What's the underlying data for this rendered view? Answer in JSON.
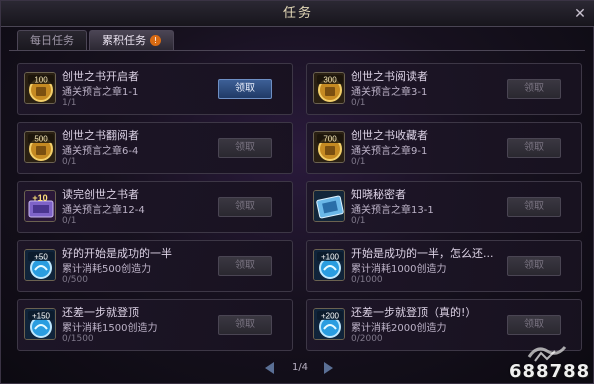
{
  "window": {
    "title": "任务"
  },
  "tabs": [
    {
      "label": "每日任务",
      "active": false
    },
    {
      "label": "累积任务",
      "active": true,
      "badge": "!"
    }
  ],
  "quests": [
    {
      "title": "创世之书开启者",
      "desc": "通关预言之章1-1",
      "progress": "1/1",
      "button": "领取",
      "claimable": true,
      "icon": "coin-100-icon",
      "icon_label": "100"
    },
    {
      "title": "创世之书阅读者",
      "desc": "通关预言之章3-1",
      "progress": "0/1",
      "button": "领取",
      "claimable": false,
      "icon": "coin-300-icon",
      "icon_label": "300"
    },
    {
      "title": "创世之书翻阅者",
      "desc": "通关预言之章6-4",
      "progress": "0/1",
      "button": "领取",
      "claimable": false,
      "icon": "coin-500-icon",
      "icon_label": "500"
    },
    {
      "title": "创世之书收藏者",
      "desc": "通关预言之章9-1",
      "progress": "0/1",
      "button": "领取",
      "claimable": false,
      "icon": "coin-700-icon",
      "icon_label": "700"
    },
    {
      "title": "读完创世之书者",
      "desc": "通关预言之章12-4",
      "progress": "0/1",
      "button": "领取",
      "claimable": false,
      "icon": "ticket-10-icon",
      "icon_label": "+10"
    },
    {
      "title": "知晓秘密者",
      "desc": "通关预言之章13-1",
      "progress": "0/1",
      "button": "领取",
      "claimable": false,
      "icon": "ticket-blue-icon",
      "icon_label": ""
    },
    {
      "title": "好的开始是成功的一半",
      "desc": "累计消耗500创造力",
      "progress": "0/500",
      "button": "领取",
      "claimable": false,
      "icon": "potion-50-icon",
      "icon_label": "+50"
    },
    {
      "title": "开始是成功的一半，怎么还...",
      "desc": "累计消耗1000创造力",
      "progress": "0/1000",
      "button": "领取",
      "claimable": false,
      "icon": "potion-100-icon",
      "icon_label": "+100"
    },
    {
      "title": "还差一步就登顶",
      "desc": "累计消耗1500创造力",
      "progress": "0/1500",
      "button": "领取",
      "claimable": false,
      "icon": "potion-150-icon",
      "icon_label": "+150"
    },
    {
      "title": "还差一步就登顶（真的!）",
      "desc": "累计消耗2000创造力",
      "progress": "0/2000",
      "button": "领取",
      "claimable": false,
      "icon": "potion-200-icon",
      "icon_label": "+200"
    }
  ],
  "pager": {
    "text": "1/4"
  },
  "watermark": {
    "number": "688788"
  },
  "colors": {
    "accent": "#3d5f96",
    "badge": "#d86a12",
    "gold": "#d9a63a",
    "blue_potion": "#2a9de0"
  }
}
